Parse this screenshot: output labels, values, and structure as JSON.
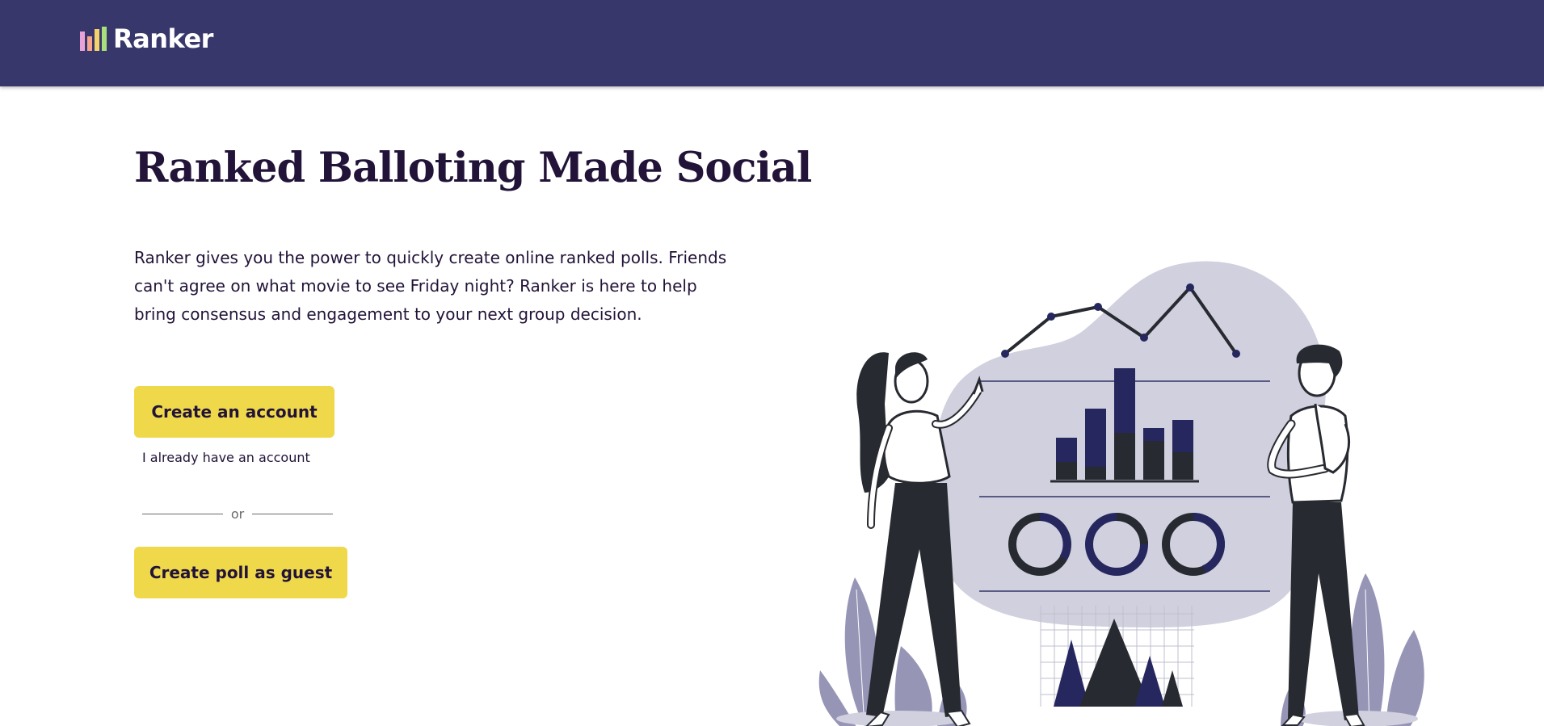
{
  "header": {
    "brand": "Ranker",
    "background_color": "#38376b",
    "logo_icon": "bar-chart-logo-icon",
    "logo_bar_colors": [
      "#e7a3d8",
      "#f4a68d",
      "#f4d36a",
      "#a9e07b"
    ]
  },
  "hero": {
    "title": "Ranked Balloting Made Social",
    "description": "Ranker gives you the power to quickly create online ranked polls. Friends can't agree on what movie to see Friday night? Ranker is here to help bring consensus and engagement to your next group decision.",
    "create_account_label": "Create an account",
    "signin_label": "I already have an account",
    "or_label": "or",
    "guest_label": "Create poll as guest",
    "button_color": "#efd94b"
  },
  "illustration": {
    "name": "people-analyzing-charts-illustration",
    "colors": {
      "navy": "#26275e",
      "dark": "#272a30",
      "blob": "#d0d0de",
      "plant": "#9695b6",
      "line": "#5a5b85"
    }
  }
}
